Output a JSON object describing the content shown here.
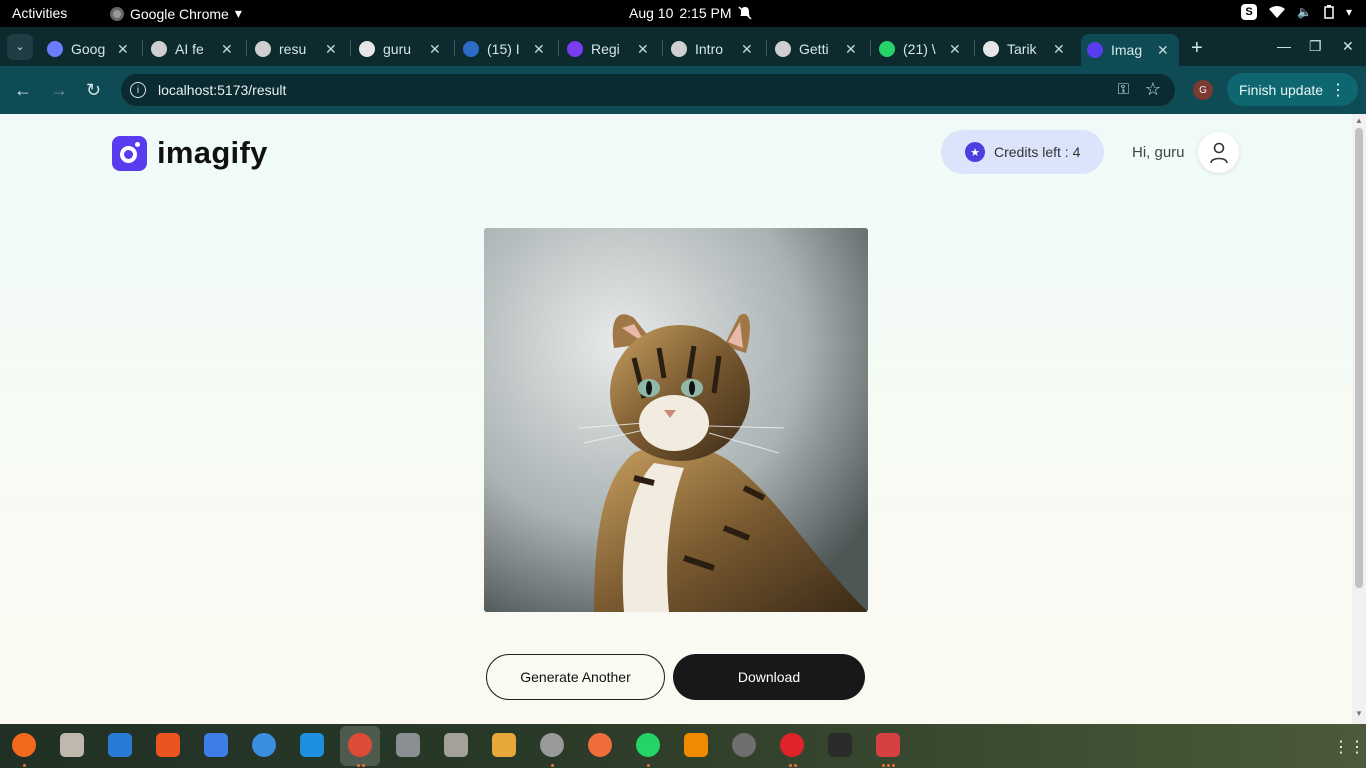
{
  "system_bar": {
    "activities": "Activities",
    "app_name": "Google Chrome",
    "date": "Aug 10",
    "time": "2:15 PM"
  },
  "tabs": [
    {
      "label": "Goog",
      "favicon": "gemini-icon",
      "color": "#6b7cff"
    },
    {
      "label": "AI fe",
      "favicon": "openai-icon",
      "color": "#cfcfcf"
    },
    {
      "label": "resu",
      "favicon": "openai-icon",
      "color": "#cfcfcf"
    },
    {
      "label": "guru",
      "favicon": "github-icon",
      "color": "#e6e6e6"
    },
    {
      "label": "(15) I",
      "favicon": "linkedin-icon",
      "color": "#2c6cc8"
    },
    {
      "label": "Regi",
      "favicon": "qdrant-icon",
      "color": "#7a3cf0"
    },
    {
      "label": "Intro",
      "favicon": "ollama-icon",
      "color": "#d0d0d0"
    },
    {
      "label": "Getti",
      "favicon": "openai-icon",
      "color": "#cfcfcf"
    },
    {
      "label": "(21) \\",
      "favicon": "whatsapp-icon",
      "color": "#25d366"
    },
    {
      "label": "Tarik",
      "favicon": "github-icon",
      "color": "#e6e6e6"
    },
    {
      "label": "Imag",
      "favicon": "imagify-icon",
      "color": "#5a3cf0",
      "active": true
    }
  ],
  "address_bar": {
    "url": "localhost:5173/result",
    "profile_initial": "G",
    "finish_update": "Finish update"
  },
  "header": {
    "logo_text": "imagify",
    "credits_label": "Credits left : 4",
    "greeting": "Hi, guru"
  },
  "result": {
    "image_subject": "tabby cat sitting against a grey wall",
    "generate_another": "Generate Another",
    "download": "Download"
  },
  "dock": [
    {
      "name": "firefox-icon",
      "color": "#f26b1d"
    },
    {
      "name": "files-icon",
      "color": "#bfb9ad"
    },
    {
      "name": "thunderbird-icon",
      "color": "#2a7bd6"
    },
    {
      "name": "software-center-icon",
      "color": "#e95420"
    },
    {
      "name": "text-editor-icon",
      "color": "#3d7ee6"
    },
    {
      "name": "help-icon",
      "color": "#3a8fe3"
    },
    {
      "name": "vscode-icon",
      "color": "#1e8fe0"
    },
    {
      "name": "chrome-icon",
      "color": "#dd4b39"
    },
    {
      "name": "screenshot-icon",
      "color": "#8a8f94"
    },
    {
      "name": "archive-icon",
      "color": "#a3a19a"
    },
    {
      "name": "image-viewer-icon",
      "color": "#e8a73a"
    },
    {
      "name": "settings-icon",
      "color": "#9a9a9a"
    },
    {
      "name": "postman-icon",
      "color": "#f26b3a"
    },
    {
      "name": "whatsapp-icon",
      "color": "#25d366"
    },
    {
      "name": "vlc-icon",
      "color": "#f08a00"
    },
    {
      "name": "app-store-icon",
      "color": "#6f6f6f"
    },
    {
      "name": "updates-icon",
      "color": "#e0242c"
    },
    {
      "name": "terminal-icon",
      "color": "#2b2b2b"
    },
    {
      "name": "document-viewer-icon",
      "color": "#d74040"
    }
  ]
}
